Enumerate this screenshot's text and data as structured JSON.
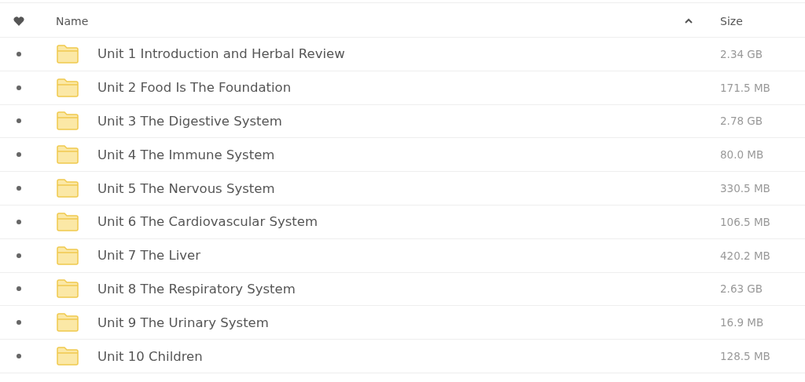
{
  "table": {
    "columns": [
      {
        "label": "Name",
        "sorted_ascending": true
      },
      {
        "label": "Size"
      }
    ],
    "rows": [
      {
        "name": "Unit 1 Introduction and Herbal Review",
        "size": "2.34 GB"
      },
      {
        "name": "Unit 2 Food Is The Foundation",
        "size": "171.5 MB"
      },
      {
        "name": "Unit 3 The Digestive System",
        "size": "2.78 GB"
      },
      {
        "name": "Unit 4 The Immune System",
        "size": "80.0 MB"
      },
      {
        "name": "Unit 5 The Nervous System",
        "size": "330.5 MB"
      },
      {
        "name": "Unit 6 The Cardiovascular System",
        "size": "106.5 MB"
      },
      {
        "name": "Unit 7 The Liver",
        "size": "420.2 MB"
      },
      {
        "name": "Unit 8 The Respiratory System",
        "size": "2.63 GB"
      },
      {
        "name": "Unit 9 The Urinary System",
        "size": "16.9 MB"
      },
      {
        "name": "Unit 10 Children",
        "size": "128.5 MB"
      }
    ]
  }
}
